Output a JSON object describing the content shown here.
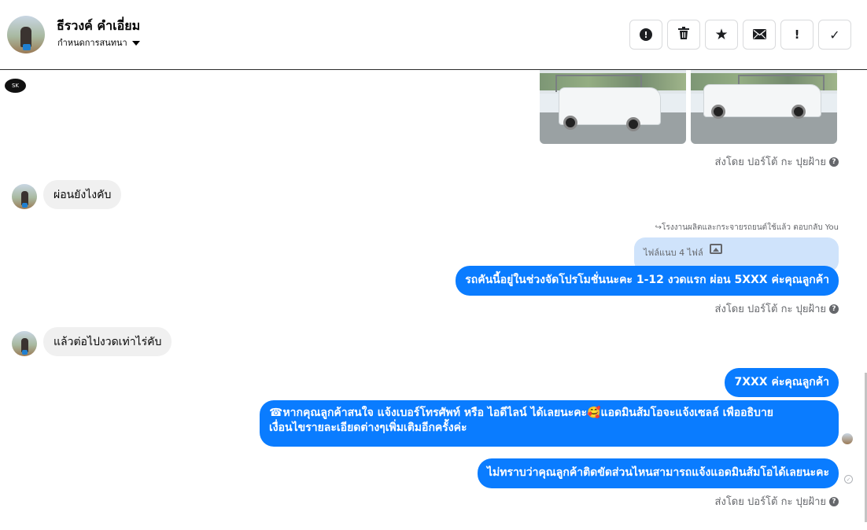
{
  "header": {
    "contact_name": "ธีรวงค์ คำเอี่ยม",
    "assign_label": "กำหนดการสนทนา"
  },
  "toolbar": {
    "buttons": [
      {
        "icon": "alert-circle-icon",
        "glyph": "!"
      },
      {
        "icon": "trash-icon",
        "glyph": "🗑"
      },
      {
        "icon": "star-icon",
        "glyph": "★"
      },
      {
        "icon": "envelope-icon",
        "glyph": "✉"
      },
      {
        "icon": "exclamation-icon",
        "glyph": "!"
      },
      {
        "icon": "checkmark-icon",
        "glyph": "✓"
      }
    ]
  },
  "page_avatar_text": "SK",
  "messages": {
    "sent_by_1": "ส่งโดย ปอร์โต้ กะ ปุยฝ้าย",
    "incoming_1": "ผ่อนยังไงคับ",
    "reply_meta": "โรงงานผลิตและกระจายรถยนต์ใช้แล้ว ตอบกลับ You",
    "quoted_attachment": "ไฟล์แนบ 4 ไฟล์",
    "outgoing_1": "รถคันนี้อยู่ในช่วงจัดโปรโมชั่นนะคะ 1-12 งวดแรก ผ่อน 5XXX ค่ะคุณลูกค้า",
    "sent_by_2": "ส่งโดย ปอร์โต้ กะ ปุยฝ้าย",
    "incoming_2": "แล้วต่อไปงวดเท่าไร่คับ",
    "outgoing_2": "7XXX ค่ะคุณลูกค้า",
    "outgoing_3_line1": "☎หากคุณลูกค้าสนใจ แจ้งเบอร์โทรศัพท์ หรือ ไอดีไลน์  ได้เลยนะคะ🥰แอดมินส้มโอจะแจ้งเซลล์   เพื่ออธิบาย",
    "outgoing_3_line2": "เงื่อนไขรายละเอียดต่างๆเพิ่มเติมอีกครั้งค่ะ",
    "outgoing_4": "ไม่ทราบว่าคุณลูกค้าติดขัดส่วนไหนสามารถแจ้งแอดมินส้มโอได้เลยนะคะ",
    "sent_by_3": "ส่งโดย ปอร์โต้ กะ ปุยฝ้าย",
    "help_glyph": "?"
  }
}
